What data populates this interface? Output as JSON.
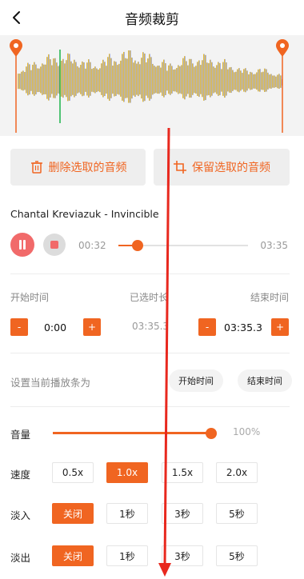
{
  "header": {
    "title": "音频裁剪",
    "back_icon": "chevron-left-icon"
  },
  "actions": {
    "delete_label": "删除选取的音频",
    "keep_label": "保留选取的音频",
    "accent": "#f06521"
  },
  "player": {
    "song_title": "Chantal Kreviazuk - Invincible",
    "current_time": "00:32",
    "total_time": "03:35",
    "progress": 0.15
  },
  "times": {
    "start_label": "开始时间",
    "selected_label": "已选时长",
    "end_label": "结束时间",
    "start_value": "0:00",
    "selected_value": "03:35.3",
    "end_value": "03:35.3",
    "minus": "-",
    "plus": "+"
  },
  "set_current": {
    "label": "设置当前播放条为",
    "start_button": "开始时间",
    "end_button": "结束时间"
  },
  "volume": {
    "label": "音量",
    "value_text": "100%",
    "level": 1.0
  },
  "speed": {
    "label": "速度",
    "options": [
      "0.5x",
      "1.0x",
      "1.5x",
      "2.0x"
    ],
    "selected": 1
  },
  "fade_in": {
    "label": "淡入",
    "options": [
      "关闭",
      "1秒",
      "3秒",
      "5秒"
    ],
    "selected": 0
  },
  "fade_out": {
    "label": "淡出",
    "options": [
      "关闭",
      "1秒",
      "3秒",
      "5秒"
    ],
    "selected": 0
  }
}
